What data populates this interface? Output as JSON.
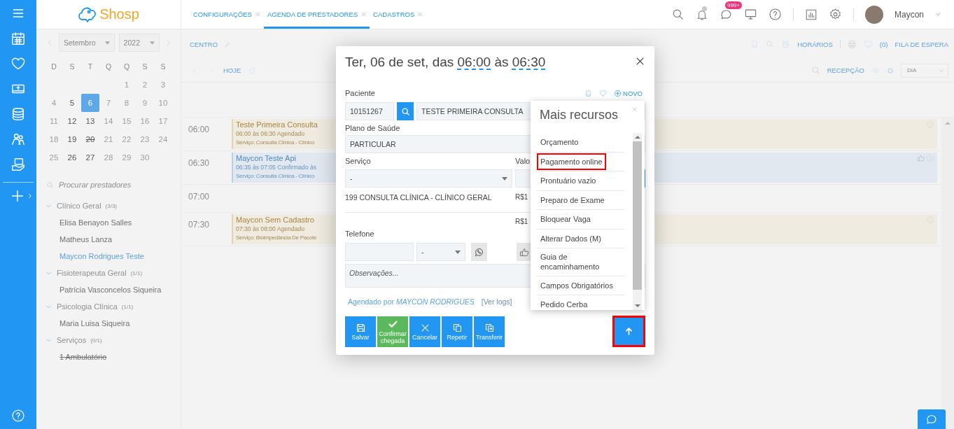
{
  "header": {
    "logo": "Shosp",
    "tabs": [
      {
        "label": "CONFIGURAÇÕES",
        "selected": false
      },
      {
        "label": "AGENDA DE PRESTADORES",
        "selected": true
      },
      {
        "label": "CADASTROS",
        "selected": false
      }
    ],
    "notifications_badge": "999+",
    "user_name": "Maycon"
  },
  "calendar": {
    "month": "Setembro",
    "year": "2022",
    "weekdays": [
      "D",
      "S",
      "T",
      "Q",
      "Q",
      "S",
      "S"
    ],
    "weeks": [
      [
        {
          "day": "1",
          "available": false,
          "blocked": false,
          "selected": false
        },
        {
          "day": "2",
          "available": false,
          "blocked": false,
          "selected": false
        },
        {
          "day": "3",
          "available": false,
          "blocked": false,
          "selected": false
        }
      ],
      [
        {
          "day": "4",
          "available": false,
          "blocked": false,
          "selected": false
        },
        {
          "day": "5",
          "available": true,
          "blocked": false,
          "selected": false
        },
        {
          "day": "6",
          "available": true,
          "blocked": false,
          "selected": true
        },
        {
          "day": "7",
          "available": false,
          "blocked": false,
          "selected": false
        },
        {
          "day": "8",
          "available": false,
          "blocked": false,
          "selected": false
        },
        {
          "day": "9",
          "available": false,
          "blocked": false,
          "selected": false
        },
        {
          "day": "10",
          "available": false,
          "blocked": false,
          "selected": false
        }
      ],
      [
        {
          "day": "11",
          "available": false,
          "blocked": false,
          "selected": false
        },
        {
          "day": "12",
          "available": true,
          "blocked": false,
          "selected": false
        },
        {
          "day": "13",
          "available": true,
          "blocked": false,
          "selected": false
        },
        {
          "day": "14",
          "available": false,
          "blocked": false,
          "selected": false
        },
        {
          "day": "15",
          "available": false,
          "blocked": false,
          "selected": false
        },
        {
          "day": "16",
          "available": false,
          "blocked": false,
          "selected": false
        },
        {
          "day": "17",
          "available": false,
          "blocked": false,
          "selected": false
        }
      ],
      [
        {
          "day": "18",
          "available": false,
          "blocked": false,
          "selected": false
        },
        {
          "day": "19",
          "available": true,
          "blocked": false,
          "selected": false
        },
        {
          "day": "20",
          "available": true,
          "blocked": true,
          "selected": false
        },
        {
          "day": "21",
          "available": false,
          "blocked": false,
          "selected": false
        },
        {
          "day": "22",
          "available": false,
          "blocked": false,
          "selected": false
        },
        {
          "day": "23",
          "available": false,
          "blocked": false,
          "selected": false
        },
        {
          "day": "24",
          "available": false,
          "blocked": false,
          "selected": false
        }
      ],
      [
        {
          "day": "25",
          "available": false,
          "blocked": false,
          "selected": false
        },
        {
          "day": "26",
          "available": true,
          "blocked": false,
          "selected": false
        },
        {
          "day": "27",
          "available": true,
          "blocked": false,
          "selected": false
        },
        {
          "day": "28",
          "available": false,
          "blocked": false,
          "selected": false
        },
        {
          "day": "29",
          "available": false,
          "blocked": false,
          "selected": false
        },
        {
          "day": "30",
          "available": false,
          "blocked": false,
          "selected": false
        }
      ]
    ]
  },
  "provider_search": {
    "placeholder": "Procurar prestadores"
  },
  "provider_groups": [
    {
      "name": "Clínico Geral",
      "count": "(3/3)",
      "expanded": true,
      "children": [
        {
          "name": "Elisa Benayon Salles",
          "selected": false,
          "inactive": false
        },
        {
          "name": "Matheus Lanza",
          "selected": false,
          "inactive": false
        },
        {
          "name": "Maycon Rodrigues Teste",
          "selected": true,
          "inactive": false
        }
      ]
    },
    {
      "name": "Fisioterapeuta Geral",
      "count": "(1/1)",
      "expanded": true,
      "children": [
        {
          "name": "Patrícia Vasconcelos Siqueira",
          "selected": false,
          "inactive": false
        }
      ]
    },
    {
      "name": "Psicologia Clínica",
      "count": "(1/1)",
      "expanded": true,
      "children": [
        {
          "name": "Maria Luisa Siqueira",
          "selected": false,
          "inactive": false
        }
      ]
    },
    {
      "name": "Serviços",
      "count": "(0/1)",
      "expanded": true,
      "children": [
        {
          "name": "1 Ambulatório",
          "selected": false,
          "inactive": true
        }
      ]
    }
  ],
  "agenda": {
    "room": "CENTRO",
    "schedules": "HORÁRIOS",
    "waiting_count": "(0)",
    "waiting_list": "FILA DE ESPERA",
    "today": "HOJE",
    "reception": "RECEPÇÃO",
    "view": "DIA",
    "slots": [
      {
        "time": "06:00",
        "event": {
          "kind": "scheduled",
          "title": "Teste Primeira Consulta",
          "time_status": "06:00 às 06:30 Agendado",
          "service": "Serviço: Consulta Clínica - Clínico",
          "liked": false
        }
      },
      {
        "time": "06:30",
        "event": {
          "kind": "confirmed",
          "title": "Maycon Teste Api",
          "time_status": "06:35 às 07:05 Confirmado às",
          "service": "Serviço: Consulta Clínica - Clínico",
          "liked": true
        }
      },
      {
        "time": "07:00"
      },
      {
        "time": "07:30",
        "event": {
          "kind": "scheduled",
          "title": "Maycon Sem Cadastro",
          "time_status": "07:30 às 08:00 Agendado",
          "service": "Serviço: Bioimpedância De Pacote",
          "liked": false
        }
      }
    ]
  },
  "appointment": {
    "title_prefix": "Ter, 06 de set, das",
    "start": "06:00",
    "between": "às",
    "end": "06:30",
    "patient_label": "Paciente",
    "new_label": "NOVO",
    "patient_code": "10151267",
    "patient_name": "TESTE PRIMEIRA CONSULTA",
    "plan_label": "Plano de Saúde",
    "plan": "PARTICULAR",
    "service_label": "Serviço",
    "value_label": "Valo",
    "service": "-",
    "service_line": "199 CONSULTA CLÍNICA - CLÍNICO GERAL",
    "service_price": "R$1",
    "total_price": "R$1",
    "phone_label": "Telefone",
    "phone_type": "-",
    "notes": {
      "placeholder": "Observações..."
    },
    "scheduled_by": "Agendado por *MAYCON RODRIGUES*",
    "logs_link": "[Ver logs]",
    "actions": [
      {
        "label": "Salvar",
        "kind": "save"
      },
      {
        "label": "Confirmar chegada",
        "kind": "confirm"
      },
      {
        "label": "Cancelar",
        "kind": "cancel"
      },
      {
        "label": "Repetir",
        "kind": "repeat"
      },
      {
        "label": "Transferir",
        "kind": "transfer"
      }
    ],
    "more_button": {
      "highlighted": true
    }
  },
  "more_resources": {
    "title": "Mais recursos",
    "items": [
      {
        "label": "Orçamento",
        "highlighted": false
      },
      {
        "label": "Pagamento online",
        "highlighted": true
      },
      {
        "label": "Prontuário vazio",
        "highlighted": false
      },
      {
        "label": "Preparo de Exame",
        "highlighted": false
      },
      {
        "label": "Bloquear Vaga",
        "highlighted": false
      },
      {
        "label": "Alterar Dados (M)",
        "highlighted": false
      },
      {
        "label": "Guia de encaminhamento",
        "highlighted": false
      },
      {
        "label": "Campos Obrigatórios",
        "highlighted": false
      },
      {
        "label": "Pedido Cerba",
        "highlighted": false
      }
    ]
  }
}
